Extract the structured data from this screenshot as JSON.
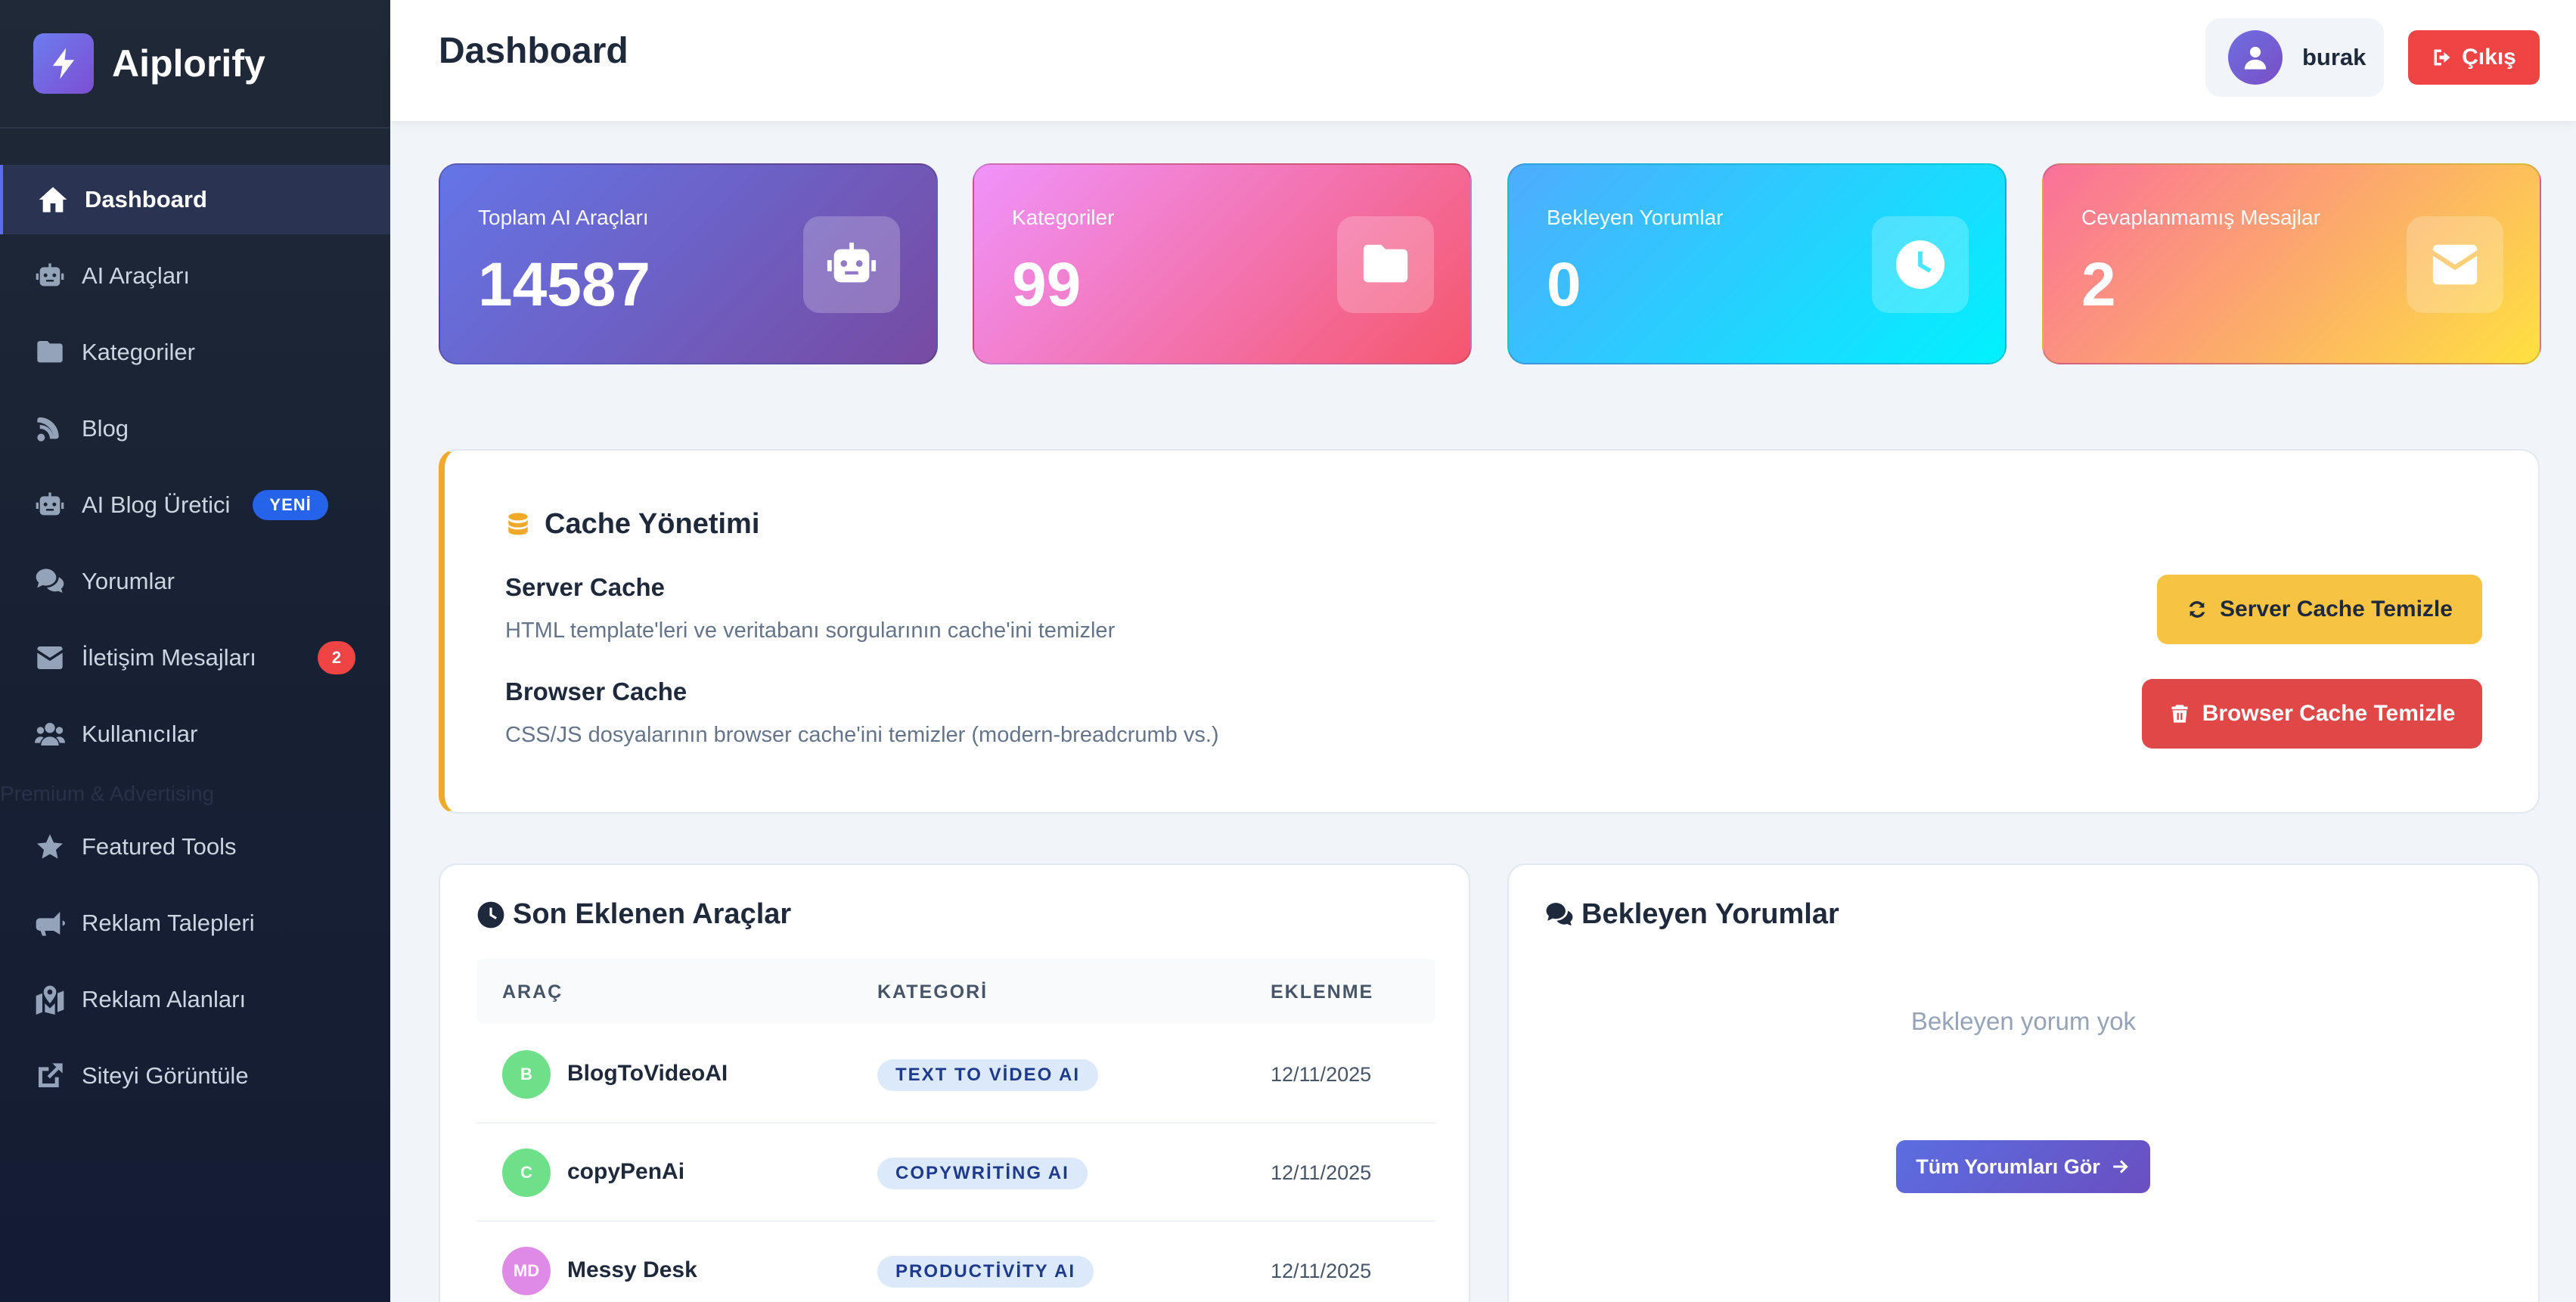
{
  "brand": {
    "name": "Aiplorify"
  },
  "sidebar": {
    "items": [
      {
        "label": "Dashboard",
        "icon": "home-icon",
        "active": true
      },
      {
        "label": "AI Araçları",
        "icon": "robot-icon"
      },
      {
        "label": "Kategoriler",
        "icon": "folder-icon"
      },
      {
        "label": "Blog",
        "icon": "blog-icon"
      },
      {
        "label": "AI Blog Üretici",
        "icon": "robot-icon",
        "badge": "YENİ"
      },
      {
        "label": "Yorumlar",
        "icon": "comments-icon"
      },
      {
        "label": "İletişim Mesajları",
        "icon": "envelope-icon",
        "count": "2"
      },
      {
        "label": "Kullanıcılar",
        "icon": "users-icon"
      }
    ],
    "section_label": "Premium & Advertising",
    "items2": [
      {
        "label": "Featured Tools",
        "icon": "star-icon"
      },
      {
        "label": "Reklam Talepleri",
        "icon": "megaphone-icon"
      },
      {
        "label": "Reklam Alanları",
        "icon": "map-icon"
      },
      {
        "label": "Siteyi Görüntüle",
        "icon": "external-link-icon"
      }
    ]
  },
  "header": {
    "title": "Dashboard",
    "user_name": "burak",
    "logout_label": "Çıkış"
  },
  "stats": [
    {
      "label": "Toplam AI Araçları",
      "value": "14587",
      "icon": "robot-icon"
    },
    {
      "label": "Kategoriler",
      "value": "99",
      "icon": "folder-icon"
    },
    {
      "label": "Bekleyen Yorumlar",
      "value": "0",
      "icon": "clock-icon"
    },
    {
      "label": "Cevaplanmamış Mesajlar",
      "value": "2",
      "icon": "envelope-icon"
    }
  ],
  "cache": {
    "title": "Cache Yönetimi",
    "server_title": "Server Cache",
    "server_desc": "HTML template'leri ve veritabanı sorgularının cache'ini temizler",
    "browser_title": "Browser Cache",
    "browser_desc": "CSS/JS dosyalarının browser cache'ini temizler (modern-breadcrumb vs.)",
    "server_button": "Server Cache Temizle",
    "browser_button": "Browser Cache Temizle"
  },
  "recent_tools": {
    "title": "Son Eklenen Araçlar",
    "columns": [
      "ARAÇ",
      "KATEGORİ",
      "EKLENME"
    ],
    "rows": [
      {
        "initials": "B",
        "name": "BlogToVideoAI",
        "category": "TEXT TO VİDEO AI",
        "date": "12/11/2025",
        "color": "#6fe08a"
      },
      {
        "initials": "C",
        "name": "copyPenAi",
        "category": "COPYWRİTİNG AI",
        "date": "12/11/2025",
        "color": "#6fe08a"
      },
      {
        "initials": "MD",
        "name": "Messy Desk",
        "category": "PRODUCTİVİTY AI",
        "date": "12/11/2025",
        "color": "#e08ae8"
      }
    ]
  },
  "pending_comments": {
    "title": "Bekleyen Yorumlar",
    "empty_text": "Bekleyen yorum yok",
    "button": "Tüm Yorumları Gör"
  },
  "colors": {
    "accent": "#5b6cf0",
    "danger": "#ef4444",
    "warning": "#f6c343"
  }
}
